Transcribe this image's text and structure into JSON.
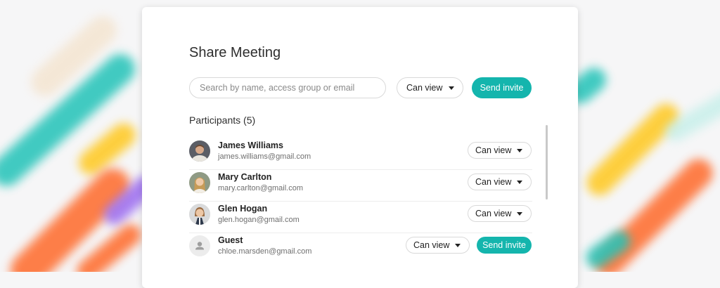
{
  "dialog": {
    "title": "Share Meeting",
    "search": {
      "placeholder": "Search by name, access group or email"
    },
    "permission": {
      "selected": "Can view"
    },
    "send_label": "Send invite",
    "participants_heading": "Participants (5)"
  },
  "participants": [
    {
      "name": "James Williams",
      "email": "james.williams@gmail.com",
      "permission": "Can view"
    },
    {
      "name": "Mary Carlton",
      "email": "mary.carlton@gmail.com",
      "permission": "Can view"
    },
    {
      "name": "Glen Hogan",
      "email": "glen.hogan@gmail.com",
      "permission": "Can view"
    },
    {
      "name": "Guest",
      "email": "chloe.marsden@gmail.com",
      "permission": "Can view",
      "action": "Send invite"
    }
  ],
  "colors": {
    "accent": "#14b5ad",
    "text": "#2e2e2e",
    "muted": "#6f6f6f",
    "border": "#d9d9d9"
  }
}
